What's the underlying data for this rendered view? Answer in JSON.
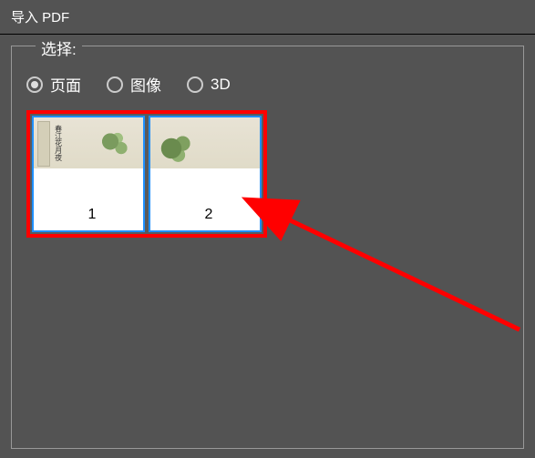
{
  "window": {
    "title": "导入 PDF"
  },
  "panel": {
    "label": "选择:"
  },
  "radios": {
    "pages": "页面",
    "images": "图像",
    "threeD": "3D",
    "selected": "pages"
  },
  "thumbnails": {
    "page1": "1",
    "page2": "2"
  }
}
